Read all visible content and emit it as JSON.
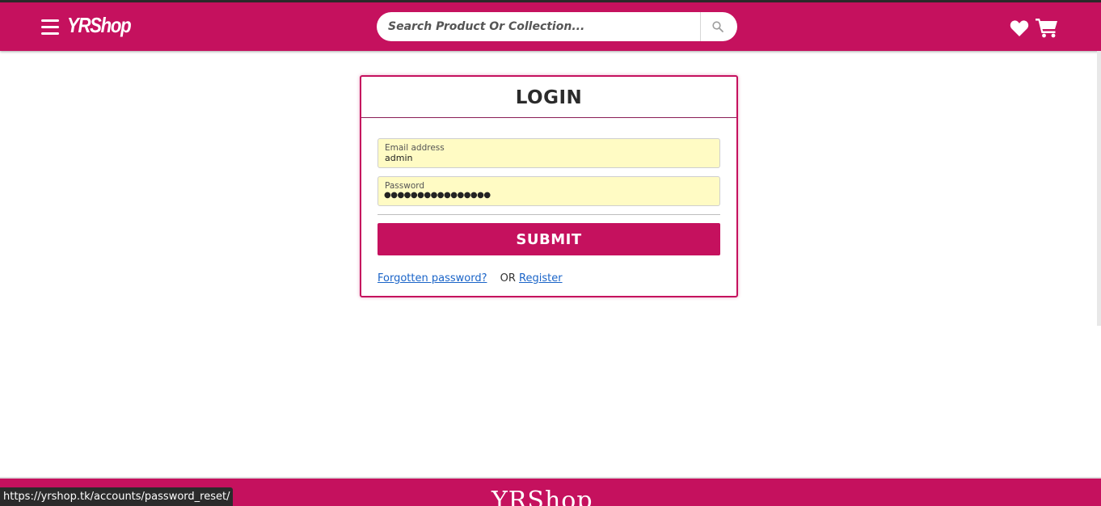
{
  "header": {
    "brand": "YRShop",
    "search_placeholder": "Search Product Or Collection...",
    "icons": [
      "hamburger-menu-icon",
      "search-icon",
      "heart-icon",
      "cart-icon"
    ],
    "accent_color": "#c5115e"
  },
  "login": {
    "title": "LOGIN",
    "email_label": "Email address",
    "email_value": "admin",
    "password_label": "Password",
    "password_dots": "●●●●●●●●●●●●●●●●",
    "submit_label": "SUBMIT",
    "forgot_link": "Forgotten password?",
    "or_text": "OR",
    "register_link": "Register"
  },
  "footer": {
    "brand": "YRShop"
  },
  "status_bar": {
    "url": "https://yrshop.tk/accounts/password_reset/"
  }
}
